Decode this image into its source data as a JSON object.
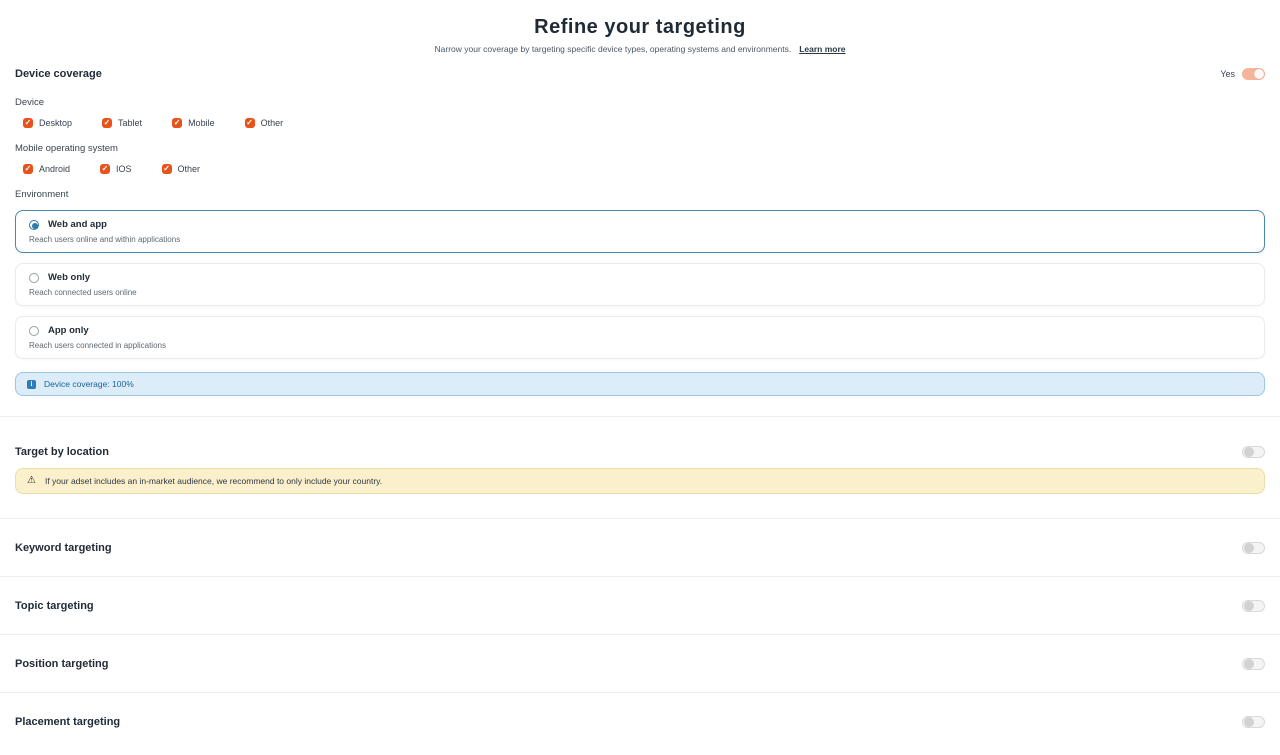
{
  "header": {
    "title": "Refine your targeting",
    "subtitle": "Narrow your coverage by targeting specific device types, operating systems and environments.",
    "learn_more": "Learn more"
  },
  "device_coverage": {
    "title": "Device coverage",
    "toggle_label": "Yes",
    "toggle_state": "on",
    "device_label": "Device",
    "devices": [
      {
        "label": "Desktop",
        "checked": true
      },
      {
        "label": "Tablet",
        "checked": true
      },
      {
        "label": "Mobile",
        "checked": true
      },
      {
        "label": "Other",
        "checked": true
      }
    ],
    "os_label": "Mobile operating system",
    "os_options": [
      {
        "label": "Android",
        "checked": true
      },
      {
        "label": "IOS",
        "checked": true
      },
      {
        "label": "Other",
        "checked": true
      }
    ],
    "environment_label": "Environment",
    "environments": [
      {
        "title": "Web and app",
        "description": "Reach users online and within applications",
        "selected": true
      },
      {
        "title": "Web only",
        "description": "Reach connected users online",
        "selected": false
      },
      {
        "title": "App only",
        "description": "Reach users connected in applications",
        "selected": false
      }
    ],
    "info_banner": {
      "icon": "info-icon",
      "text": "Device coverage: 100%"
    }
  },
  "location": {
    "title": "Target by location",
    "toggle_state": "off",
    "warning": {
      "icon": "warning-icon",
      "text": "If your adset includes an in-market audience, we recommend to only include your country."
    }
  },
  "sections": [
    {
      "title": "Keyword targeting",
      "toggle_state": "off"
    },
    {
      "title": "Topic targeting",
      "toggle_state": "off"
    },
    {
      "title": "Position targeting",
      "toggle_state": "off"
    },
    {
      "title": "Placement targeting",
      "toggle_state": "off"
    }
  ],
  "icons": {
    "checkbox_check": "✓",
    "info": "i",
    "warning": "⚠"
  },
  "colors": {
    "accent_orange": "#E8531B",
    "toggle_on_track": "#F5B49C",
    "toggle_off_track": "#F4F4F4",
    "selected_card_border": "#4B86AB",
    "radio_selected": "#2E7AAB",
    "info_bg": "#DCEDF9",
    "info_border": "#9BC5E2",
    "info_text": "#1C6399",
    "warning_bg": "#FAF0CB",
    "warning_border": "#ECDDA6",
    "heading_text": "#212C38"
  }
}
